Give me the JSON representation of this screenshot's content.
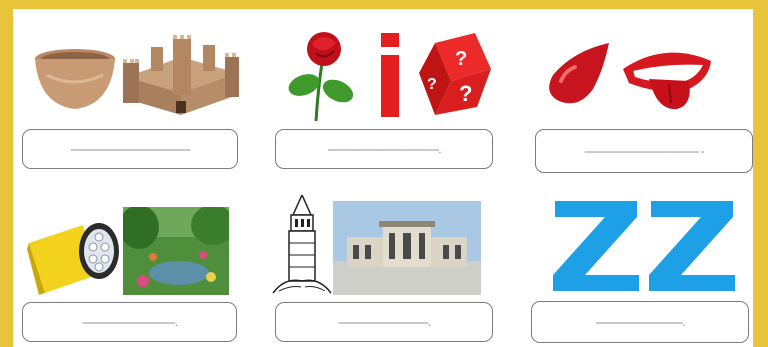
{
  "worksheet": {
    "answer_lines": [
      "----------------------------------------",
      "-------------------------------------.",
      "-------------------------------------- -",
      "-------------------------------.",
      "------------------------------.",
      "-----------------------------."
    ],
    "puzzle_letters": "ZZ",
    "colors": {
      "frame": "#e8c43a",
      "letters": "#1ea0e6",
      "drop": "#c8141e",
      "flashlight": "#f2d21c"
    }
  }
}
